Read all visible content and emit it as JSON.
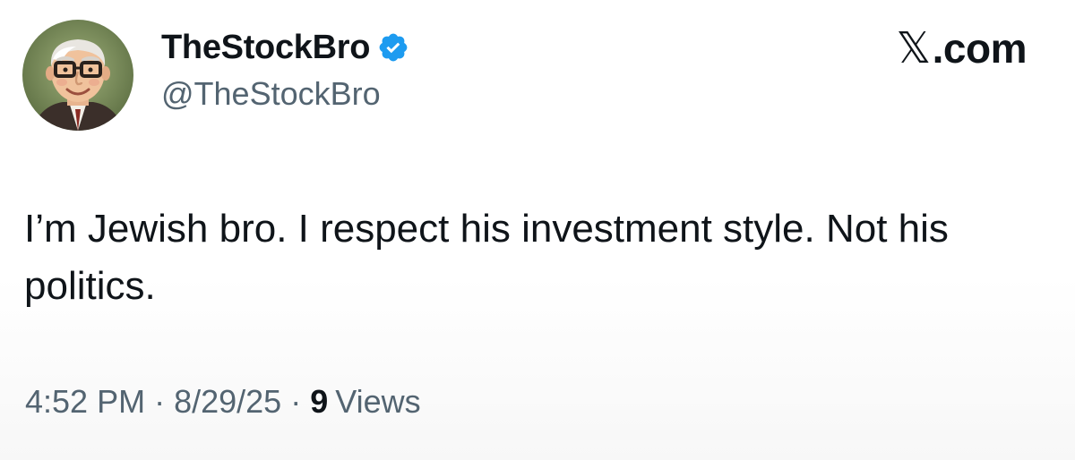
{
  "author": {
    "display_name": "TheStockBro",
    "handle": "@TheStockBro",
    "verified": true,
    "avatar_icon": "cartoon-elderly-man-glasses-avatar"
  },
  "brand": {
    "logo_text": ".com",
    "logo_icon": "x-logo-icon"
  },
  "tweet": {
    "text": "I’m Jewish bro. I respect his investment style. Not his politics."
  },
  "meta": {
    "time": "4:52 PM",
    "separator": "·",
    "date": "8/29/25",
    "views_count": "9",
    "views_label": "Views"
  },
  "colors": {
    "text_primary": "#0f1419",
    "text_secondary": "#536471",
    "verified_blue": "#1d9bf0"
  }
}
